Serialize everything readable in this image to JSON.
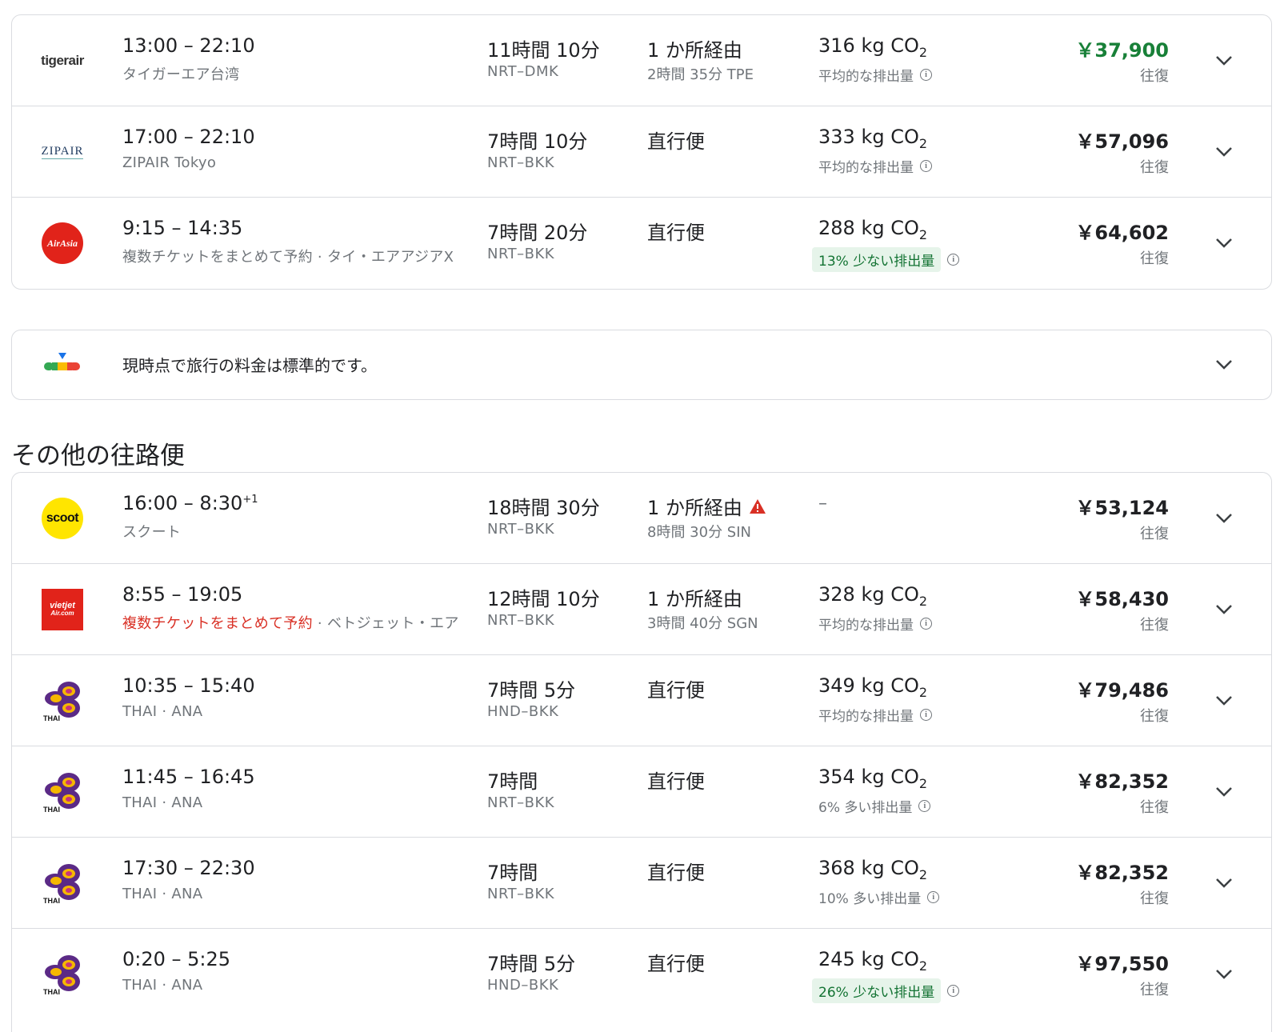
{
  "top_flights": [
    {
      "times": "13:00 – 22:10",
      "arr_suffix": "",
      "airline": "タイガーエア台湾",
      "airline_warn": "",
      "duration": "11時間 10分",
      "route": "NRT–DMK",
      "stops": "1 か所経由",
      "layover": "2時間 35分 TPE",
      "co2": "316 kg CO",
      "emissions": "平均的な排出量",
      "emissions_style": "plain",
      "price": "￥37,900",
      "price_style": "green",
      "trip": "往復",
      "logo": "tigerair-logo"
    },
    {
      "times": "17:00 – 22:10",
      "arr_suffix": "",
      "airline": "ZIPAIR Tokyo",
      "airline_warn": "",
      "duration": "7時間 10分",
      "route": "NRT–BKK",
      "stops": "直行便",
      "layover": "",
      "co2": "333 kg CO",
      "emissions": "平均的な排出量",
      "emissions_style": "plain",
      "price": "￥57,096",
      "price_style": "normal",
      "trip": "往復",
      "logo": "zipair-logo"
    },
    {
      "times": "9:15 – 14:35",
      "arr_suffix": "",
      "airline": "複数チケットをまとめて予約 · タイ・エアアジアX",
      "airline_warn": "",
      "duration": "7時間 20分",
      "route": "NRT–BKK",
      "stops": "直行便",
      "layover": "",
      "co2": "288 kg CO",
      "emissions": "13% 少ない排出量",
      "emissions_style": "chip",
      "price": "￥64,602",
      "price_style": "normal",
      "trip": "往復",
      "logo": "airasia-logo"
    }
  ],
  "insight": {
    "message": "現時点で旅行の料金は標準的です。"
  },
  "other_section": {
    "title": "その他の往路便"
  },
  "other_flights": [
    {
      "times": "16:00 – 8:30",
      "arr_suffix": "+1",
      "airline": "スクート",
      "airline_warn": "",
      "duration": "18時間 30分",
      "route": "NRT–BKK",
      "stops": "1 か所経由",
      "stops_warning": true,
      "layover": "8時間 30分 SIN",
      "co2": "",
      "emissions": "",
      "emissions_style": "none",
      "price": "￥53,124",
      "price_style": "normal",
      "trip": "往復",
      "logo": "scoot-logo",
      "co2_dash": "–"
    },
    {
      "times": "8:55 – 19:05",
      "arr_suffix": "",
      "airline_warn": "複数チケットをまとめて予約",
      "airline": " · ベトジェット・エア",
      "duration": "12時間 10分",
      "route": "NRT–BKK",
      "stops": "1 か所経由",
      "layover": "3時間 40分 SGN",
      "co2": "328 kg CO",
      "emissions": "平均的な排出量",
      "emissions_style": "plain",
      "price": "￥58,430",
      "price_style": "normal",
      "trip": "往復",
      "logo": "vietjet-logo"
    },
    {
      "times": "10:35 – 15:40",
      "arr_suffix": "",
      "airline": "THAI · ANA",
      "airline_warn": "",
      "duration": "7時間 5分",
      "route": "HND–BKK",
      "stops": "直行便",
      "layover": "",
      "co2": "349 kg CO",
      "emissions": "平均的な排出量",
      "emissions_style": "plain",
      "price": "￥79,486",
      "price_style": "normal",
      "trip": "往復",
      "logo": "thai-logo"
    },
    {
      "times": "11:45 – 16:45",
      "arr_suffix": "",
      "airline": "THAI · ANA",
      "airline_warn": "",
      "duration": "7時間",
      "route": "NRT–BKK",
      "stops": "直行便",
      "layover": "",
      "co2": "354 kg CO",
      "emissions": "6% 多い排出量",
      "emissions_style": "plain",
      "price": "￥82,352",
      "price_style": "normal",
      "trip": "往復",
      "logo": "thai-logo"
    },
    {
      "times": "17:30 – 22:30",
      "arr_suffix": "",
      "airline": "THAI · ANA",
      "airline_warn": "",
      "duration": "7時間",
      "route": "NRT–BKK",
      "stops": "直行便",
      "layover": "",
      "co2": "368 kg CO",
      "emissions": "10% 多い排出量",
      "emissions_style": "plain",
      "price": "￥82,352",
      "price_style": "normal",
      "trip": "往復",
      "logo": "thai-logo"
    },
    {
      "times": "0:20 – 5:25",
      "arr_suffix": "",
      "airline": "THAI · ANA",
      "airline_warn": "",
      "duration": "7時間 5分",
      "route": "HND–BKK",
      "stops": "直行便",
      "layover": "",
      "co2": "245 kg CO",
      "emissions": "26% 少ない排出量",
      "emissions_style": "chip",
      "price": "￥97,550",
      "price_style": "normal",
      "trip": "往復",
      "logo": "thai-logo"
    }
  ],
  "logos": {
    "tigerair": "tigerair",
    "zipair": "ZIPAIR",
    "airasia": "AirAsia",
    "scoot": "scoot",
    "vietjet": "vietjet",
    "vietjet_sub": "Air.com",
    "thai": "THAI"
  },
  "colors": {
    "green_price": "#188038",
    "chip_bg": "#e6f4ea",
    "chip_text": "#137333",
    "warn_red": "#d93025",
    "airasia_red": "#e1231a",
    "scoot_yellow": "#ffe500",
    "thai_purple": "#5b2a86",
    "thai_gold": "#f5b700"
  }
}
